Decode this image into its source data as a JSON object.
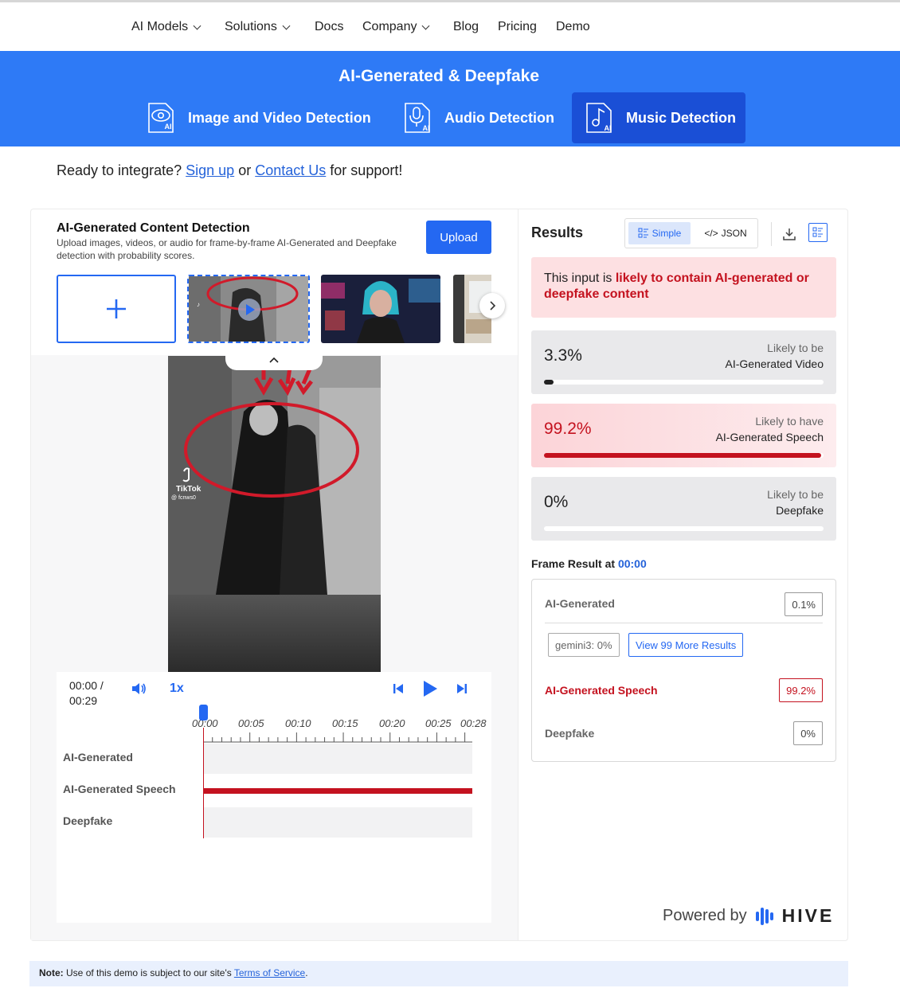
{
  "nav": {
    "items": [
      {
        "label": "AI Models",
        "dropdown": true
      },
      {
        "label": "Solutions",
        "dropdown": true
      },
      {
        "label": "Docs",
        "dropdown": false
      },
      {
        "label": "Company",
        "dropdown": true
      },
      {
        "label": "Blog",
        "dropdown": false
      },
      {
        "label": "Pricing",
        "dropdown": false
      },
      {
        "label": "Demo",
        "dropdown": false
      }
    ]
  },
  "banner": {
    "title": "AI-Generated & Deepfake",
    "tabs": [
      {
        "label": "Image and Video Detection",
        "icon": "eye-ai-icon",
        "active": false
      },
      {
        "label": "Audio Detection",
        "icon": "mic-ai-icon",
        "active": false
      },
      {
        "label": "Music Detection",
        "icon": "music-ai-icon",
        "active": true
      }
    ],
    "icon_badge": "AI"
  },
  "integrate": {
    "prefix": "Ready to integrate?",
    "signup": "Sign up",
    "or": "or",
    "contact": "Contact Us",
    "suffix": "for support!"
  },
  "detection": {
    "title": "AI-Generated Content Detection",
    "subtitle": "Upload images, videos, or audio for frame-by-frame AI-Generated and Deepfake detection with probability scores.",
    "upload_label": "Upload",
    "add_label": "+"
  },
  "video": {
    "watermark": "TikTok",
    "handle": "@ fcnws0"
  },
  "player": {
    "time_current": "00:00 /",
    "time_total": "00:29",
    "rate": "1x",
    "ticks": [
      "00:00",
      "00:05",
      "00:10",
      "00:15",
      "00:20",
      "00:25",
      "00:28"
    ],
    "tracks": [
      {
        "label": "AI-Generated",
        "active": false
      },
      {
        "label": "AI-Generated Speech",
        "active": true
      },
      {
        "label": "Deepfake",
        "active": false
      }
    ]
  },
  "results": {
    "title": "Results",
    "view_simple": "Simple",
    "view_json": "JSON",
    "alert_prefix": "This input is",
    "alert_bold": "likely to contain AI-generated or deepfake content",
    "scores": [
      {
        "pct": "3.3%",
        "line1": "Likely to be",
        "line2": "AI-Generated Video",
        "fraction": 0.033,
        "hot": false
      },
      {
        "pct": "99.2%",
        "line1": "Likely to have",
        "line2": "AI-Generated Speech",
        "fraction": 0.992,
        "hot": true
      },
      {
        "pct": "0%",
        "line1": "Likely to be",
        "line2": "Deepfake",
        "fraction": 0,
        "hot": false
      }
    ],
    "frame_label": "Frame Result at",
    "frame_time": "00:00",
    "frame_rows": {
      "ai_generated": {
        "label": "AI-Generated",
        "value": "0.1%"
      },
      "gemini": "gemini3: 0%",
      "more": "View 99 More Results",
      "speech": {
        "label": "AI-Generated Speech",
        "value": "99.2%"
      },
      "deepfake": {
        "label": "Deepfake",
        "value": "0%"
      }
    },
    "powered_by": "Powered by",
    "brand": "HIVE"
  },
  "note": {
    "bold": "Note:",
    "text": "Use of this demo is subject to our site's",
    "link": "Terms of Service",
    "end": "."
  },
  "colors": {
    "primary": "#2468f2",
    "banner": "#2e7af6",
    "danger": "#c4121f"
  }
}
